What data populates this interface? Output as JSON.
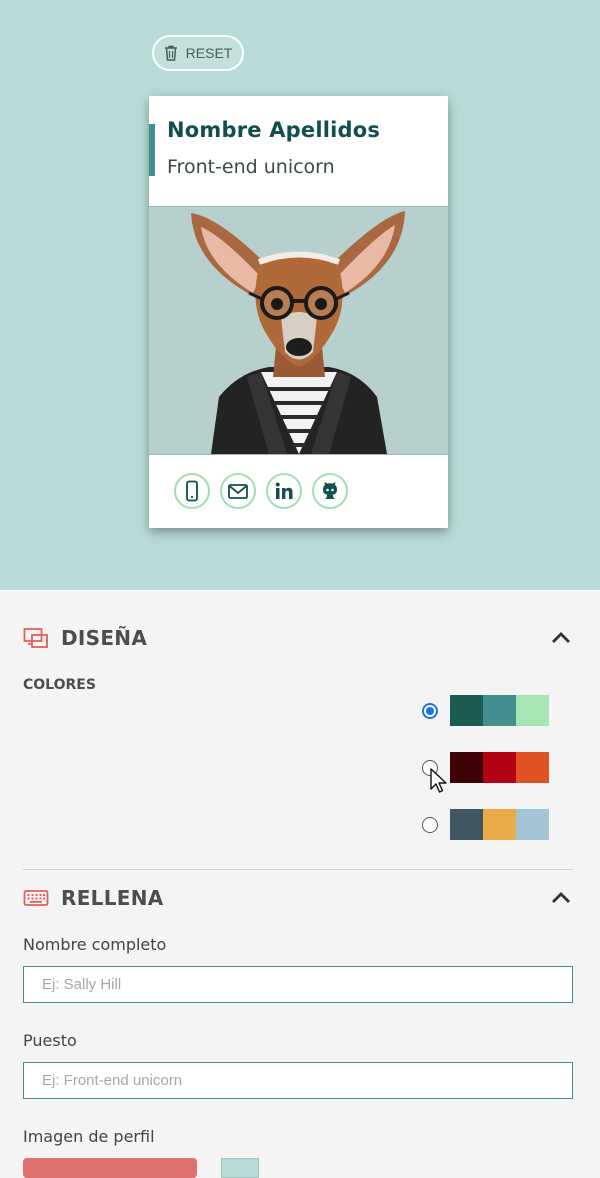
{
  "preview": {
    "background": "#b9dbd7",
    "reset_label": "RESET",
    "card": {
      "name": "Nombre Apellidos",
      "job": "Front-end unicorn",
      "accent_color": "#438e8f",
      "name_color": "#114e4e",
      "photo_alt": "deer-with-glasses-photo",
      "social_icons": [
        "phone-icon",
        "mail-icon",
        "linkedin-icon",
        "github-icon"
      ]
    }
  },
  "design": {
    "title": "DISEÑA",
    "colors_label": "COLORES",
    "palettes": [
      {
        "selected": true,
        "colors": [
          "#1b5b52",
          "#438e8f",
          "#a7e5b3"
        ]
      },
      {
        "selected": false,
        "colors": [
          "#3f0204",
          "#b30012",
          "#e05224"
        ]
      },
      {
        "selected": false,
        "colors": [
          "#3f5760",
          "#e9aa47",
          "#a3c4d2"
        ]
      }
    ]
  },
  "fill": {
    "title": "RELLENA",
    "name_label": "Nombre completo",
    "name_placeholder": "Ej: Sally Hill",
    "job_label": "Puesto",
    "job_placeholder": "Ej: Front-end unicorn",
    "image_label": "Imagen de perfil"
  },
  "colors": {
    "section_icon": "#e15f5f",
    "page_background": "#f4f4f4"
  }
}
